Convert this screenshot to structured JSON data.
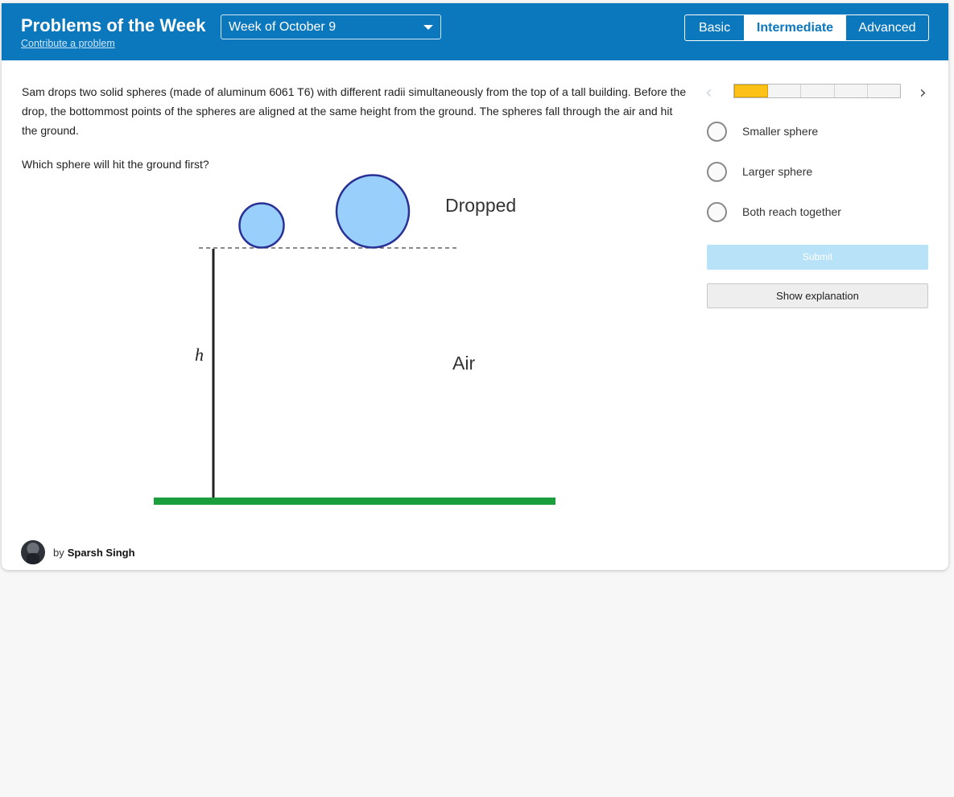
{
  "header": {
    "title": "Problems of the Week",
    "contribute_link": "Contribute a problem",
    "week_select": "Week of October 9",
    "levels": [
      "Basic",
      "Intermediate",
      "Advanced"
    ],
    "selected_level": "Intermediate",
    "background_color": "#0b77bd"
  },
  "problem": {
    "text": "Sam drops two solid spheres (made of aluminum 6061 T6) with different radii simultaneously from the top of a tall building. Before the drop, the bottommost points of the spheres are aligned at the same height from the ground. The spheres fall through the air and hit the ground.",
    "question": "Which sphere will hit the ground first?"
  },
  "diagram": {
    "label_dropped": "Dropped",
    "label_air": "Air",
    "label_height": "h",
    "sphere_fill": "#99d0fb",
    "sphere_stroke": "#2a3194",
    "ground_color": "#1c9e3c"
  },
  "progress": {
    "completed": 1,
    "total": 5,
    "prev_icon": "chevron-left-icon",
    "next_icon": "chevron-right-icon"
  },
  "options": [
    "Smaller sphere",
    "Larger sphere",
    "Both reach together"
  ],
  "buttons": {
    "submit": "Submit",
    "explanation": "Show explanation"
  },
  "author": {
    "by": "by",
    "name": "Sparsh Singh"
  }
}
